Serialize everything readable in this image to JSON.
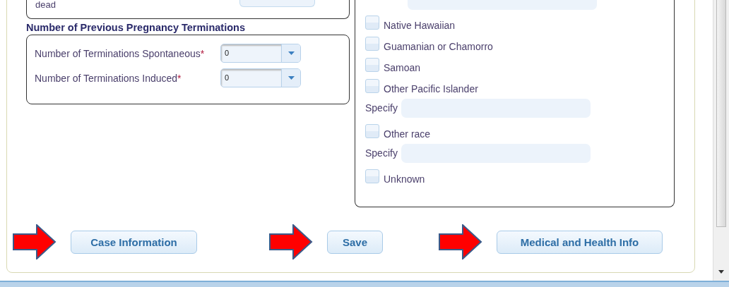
{
  "outcomes": {
    "last_label": "dead"
  },
  "terminations": {
    "title": "Number of Previous Pregnancy Terminations",
    "fields": [
      {
        "label": "Number of Terminations Spontaneous",
        "required_mark": "*",
        "value": "0"
      },
      {
        "label": "Number of Terminations Induced",
        "required_mark": "*",
        "value": "0"
      }
    ]
  },
  "race_options": [
    {
      "kind": "specify"
    },
    {
      "kind": "checkbox",
      "label": "Native Hawaiian",
      "checked": false
    },
    {
      "kind": "checkbox",
      "label": "Guamanian or Chamorro",
      "checked": false
    },
    {
      "kind": "checkbox",
      "label": "Samoan",
      "checked": false
    },
    {
      "kind": "checkbox",
      "label": "Other Pacific Islander",
      "checked": false
    },
    {
      "kind": "specify",
      "label": "Specify"
    },
    {
      "kind": "checkbox",
      "label": "Other race",
      "checked": false
    },
    {
      "kind": "specify",
      "label": "Specify"
    },
    {
      "kind": "checkbox",
      "label": "Unknown",
      "checked": false
    }
  ],
  "buttons": [
    {
      "label": "Case Information"
    },
    {
      "label": "Save"
    },
    {
      "label": "Medical and Health Info"
    }
  ]
}
